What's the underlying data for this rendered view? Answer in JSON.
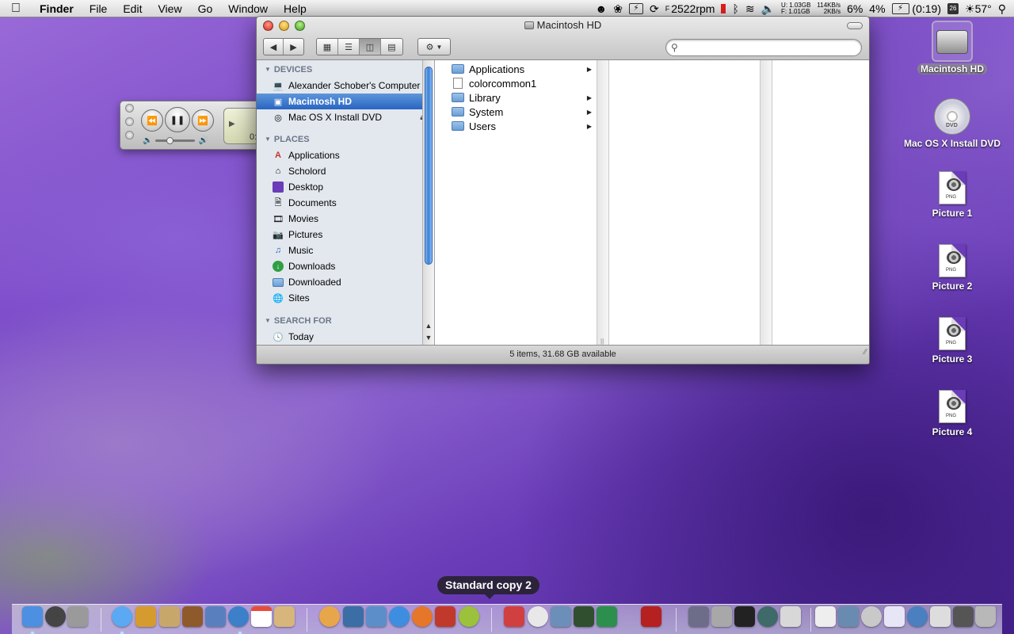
{
  "menubar": {
    "app_name": "Finder",
    "menus": [
      "File",
      "Edit",
      "View",
      "Go",
      "Window",
      "Help"
    ],
    "fan_speed": "2522rpm",
    "mem_u": "U: 1.03GB",
    "mem_f": "F: 1.01GB",
    "net_up": "114KB/s",
    "net_down": "2KB/s",
    "cpu1": "6%",
    "cpu2": "4%",
    "battery": "(0:19)",
    "date_day": "26",
    "temperature": "57°"
  },
  "finder": {
    "title": "Macintosh HD",
    "search_placeholder": "",
    "sidebar": {
      "devices_header": "DEVICES",
      "devices": [
        {
          "label": "Alexander Schober's Computer",
          "icon": "computer-icon"
        },
        {
          "label": "Macintosh HD",
          "icon": "hard-drive-icon",
          "selected": true
        },
        {
          "label": "Mac OS X Install DVD",
          "icon": "dvd-icon",
          "eject": true
        }
      ],
      "places_header": "PLACES",
      "places": [
        {
          "label": "Applications",
          "icon": "applications-icon"
        },
        {
          "label": "Scholord",
          "icon": "home-icon"
        },
        {
          "label": "Desktop",
          "icon": "desktop-icon"
        },
        {
          "label": "Documents",
          "icon": "documents-icon"
        },
        {
          "label": "Movies",
          "icon": "movies-icon"
        },
        {
          "label": "Pictures",
          "icon": "pictures-icon"
        },
        {
          "label": "Music",
          "icon": "music-icon"
        },
        {
          "label": "Downloads",
          "icon": "downloads-icon"
        },
        {
          "label": "Downloaded",
          "icon": "folder-icon"
        },
        {
          "label": "Sites",
          "icon": "sites-icon"
        }
      ],
      "search_header": "SEARCH FOR",
      "search_items": [
        {
          "label": "Today",
          "icon": "clock-icon"
        }
      ]
    },
    "column1": [
      {
        "label": "Applications",
        "type": "folder",
        "has_children": true
      },
      {
        "label": "colorcommon1",
        "type": "file",
        "has_children": false
      },
      {
        "label": "Library",
        "type": "folder",
        "has_children": true
      },
      {
        "label": "System",
        "type": "folder",
        "has_children": true
      },
      {
        "label": "Users",
        "type": "folder",
        "has_children": true
      }
    ],
    "status": "5 items, 31.68 GB available"
  },
  "desktop": {
    "icons": [
      {
        "label": "Macintosh HD",
        "kind": "hard-drive",
        "selected": true
      },
      {
        "label": "Mac OS X Install DVD",
        "kind": "dvd"
      },
      {
        "label": "Picture 1",
        "kind": "png"
      },
      {
        "label": "Picture 2",
        "kind": "png"
      },
      {
        "label": "Picture 3",
        "kind": "png"
      },
      {
        "label": "Picture 4",
        "kind": "png"
      }
    ],
    "png_tag": "PNG",
    "dvd_tag": "DVD"
  },
  "miniplayer": {
    "time_partial": "0:"
  },
  "dock": {
    "tooltip": "Standard copy 2",
    "colors": {
      "finder": "#4d8fe0",
      "dashboard": "#444444",
      "prefs": "#9a9a9a",
      "itunes": "#5aa9f2",
      "iphoto": "#d69b2f",
      "imovie": "#5a7fbf",
      "ical": "#e84b3c",
      "mail": "#d8b57a",
      "firefox": "#e5762a",
      "safari": "#3d8ee0",
      "terminal": "#222222",
      "trash": "#b8b8b8"
    }
  }
}
